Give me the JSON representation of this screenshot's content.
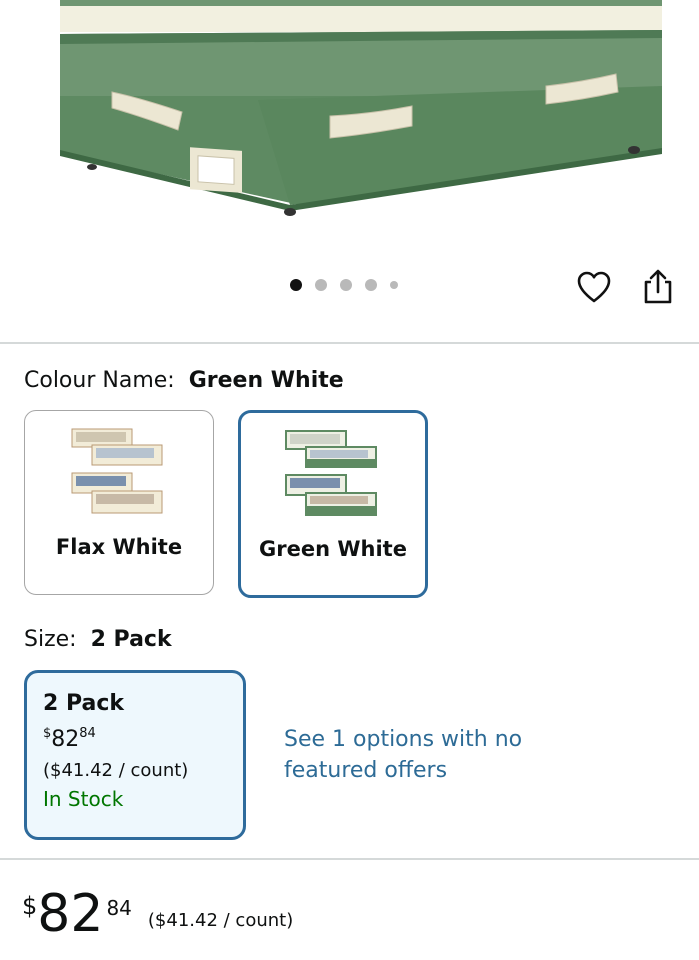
{
  "gallery": {
    "dot_count": 5,
    "active_dot": 0
  },
  "icons": {
    "favorite": "heart-icon",
    "share": "share-icon"
  },
  "colour": {
    "label": "Colour Name:",
    "selected": "Green White",
    "options": [
      {
        "name": "Flax White",
        "selected": false
      },
      {
        "name": "Green White",
        "selected": true
      }
    ]
  },
  "size": {
    "label": "Size:",
    "selected": "2 Pack",
    "option": {
      "title": "2 Pack",
      "price_symbol": "$",
      "price_whole": "82",
      "price_fraction": "84",
      "unit_price": "($41.42 / count)",
      "stock": "In Stock"
    },
    "see_options": "See 1 options with no featured offers"
  },
  "price": {
    "symbol": "$",
    "whole": "82",
    "fraction": "84",
    "unit_price": "($41.42 / count)"
  },
  "colors": {
    "accent_border": "#2e6b9c",
    "link": "#2d6b96",
    "in_stock": "#007600",
    "box_green": "#5e8a62",
    "box_cream": "#f2f0e0"
  }
}
